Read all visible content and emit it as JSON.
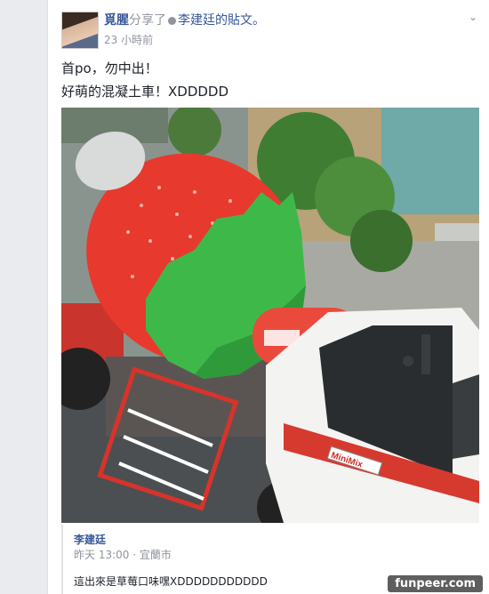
{
  "post": {
    "author": "覓腥",
    "action": "分享了",
    "shared_from": "李建廷的貼文。",
    "time": "23 小時前",
    "text_line1": "首po，勿中出！",
    "text_line2": "好萌的混凝土車！XDDDDD"
  },
  "photo": {
    "truck_door_text": "MiniMix"
  },
  "shared_post": {
    "author": "李建廷",
    "meta": "昨天 13:00 · 宜蘭市",
    "text": "這出來是草莓口味嘿XDDDDDDDDDDD"
  },
  "watermark": "funpeer.com",
  "colors": {
    "link": "#365899",
    "muted": "#90949c",
    "strawberry_red": "#e8392e",
    "leaf_green": "#3fb84a"
  },
  "icons": [
    "avatar",
    "verified-icon",
    "chevron-down-icon"
  ]
}
